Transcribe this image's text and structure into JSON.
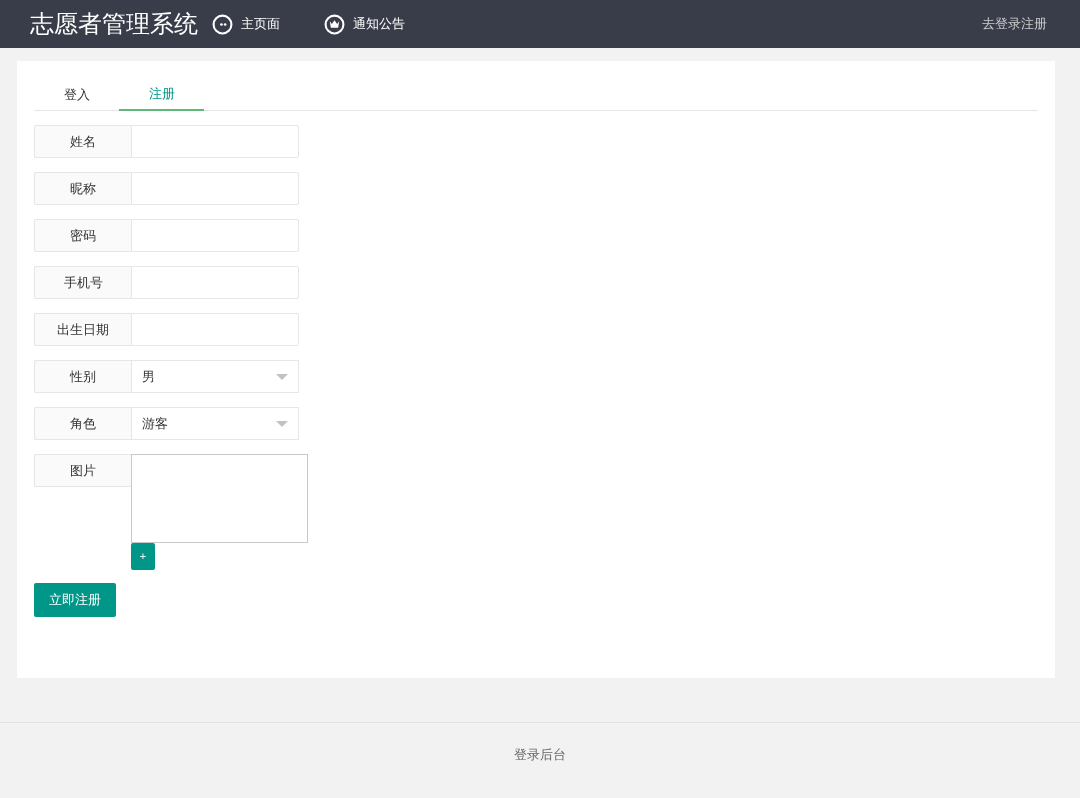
{
  "header": {
    "title": "志愿者管理系统",
    "nav": [
      {
        "label": "主页面"
      },
      {
        "label": "通知公告"
      }
    ],
    "login_link": "去登录注册"
  },
  "tabs": [
    {
      "label": "登入",
      "selected": false
    },
    {
      "label": "注册",
      "selected": true
    }
  ],
  "fields": [
    {
      "kind": "text",
      "label": "姓名"
    },
    {
      "kind": "text",
      "label": "昵称"
    },
    {
      "kind": "text",
      "label": "密码"
    },
    {
      "kind": "text",
      "label": "手机号"
    },
    {
      "kind": "text",
      "label": "出生日期"
    },
    {
      "kind": "select",
      "label": "性别",
      "value": "男"
    },
    {
      "kind": "select",
      "label": "角色",
      "value": "游客"
    },
    {
      "kind": "image",
      "label": "图片",
      "button": "+"
    }
  ],
  "submit": "立即注册",
  "footer": {
    "link": "登录后台"
  }
}
